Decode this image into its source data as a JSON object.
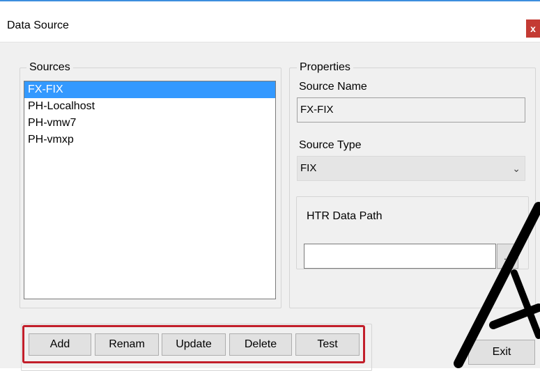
{
  "window": {
    "title": "Data Source",
    "close_label": "x"
  },
  "sources": {
    "legend": "Sources",
    "items": [
      "FX-FIX",
      "PH-Localhost",
      "PH-vmw7",
      "PH-vmxp"
    ],
    "selected_index": 0
  },
  "properties": {
    "legend": "Properties",
    "source_name_label": "Source Name",
    "source_name_value": "FX-FIX",
    "source_type_label": "Source Type",
    "source_type_value": "FIX",
    "htr_path_label": "HTR Data Path",
    "htr_path_value": "",
    "browse_label": "..."
  },
  "buttons": {
    "add": "Add",
    "rename": "Renam",
    "update": "Update",
    "delete": "Delete",
    "test": "Test",
    "exit": "Exit"
  },
  "colors": {
    "selection": "#3399ff",
    "highlight_border": "#c21e2a",
    "close_button": "#c43b34"
  }
}
